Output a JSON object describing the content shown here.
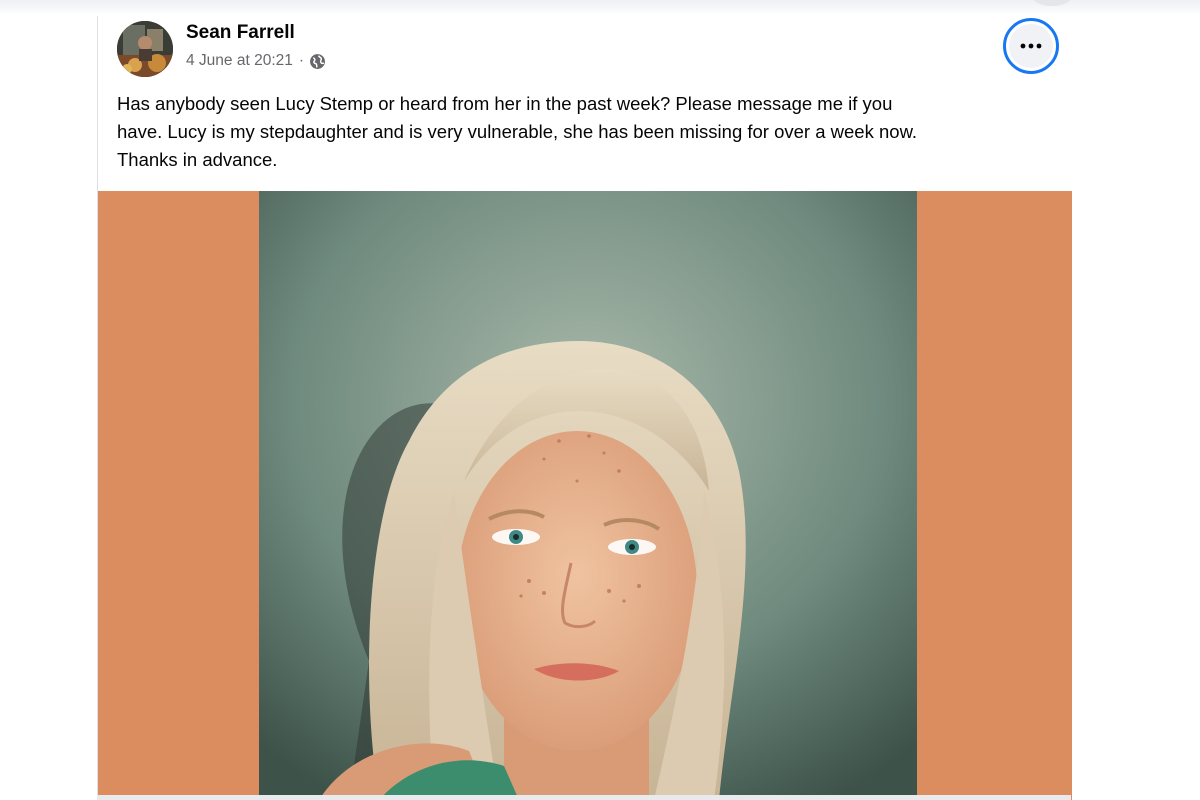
{
  "post": {
    "author": "Sean Farrell",
    "timestamp": "4 June at 20:21",
    "separator": "·",
    "audience_icon": "globe-icon",
    "more_icon": "more-options-icon",
    "message": "Has anybody seen Lucy Stemp or heard from her in the past week? Please message me if you\nhave. Lucy is my stepdaughter and is very vulnerable, she has been missing for over a week now.\nThanks in advance.",
    "photo_description": "Portrait of Lucy Stemp"
  },
  "colors": {
    "accent": "#1877f2",
    "media_background": "#dc8d60",
    "secondary_text": "#65676b"
  }
}
